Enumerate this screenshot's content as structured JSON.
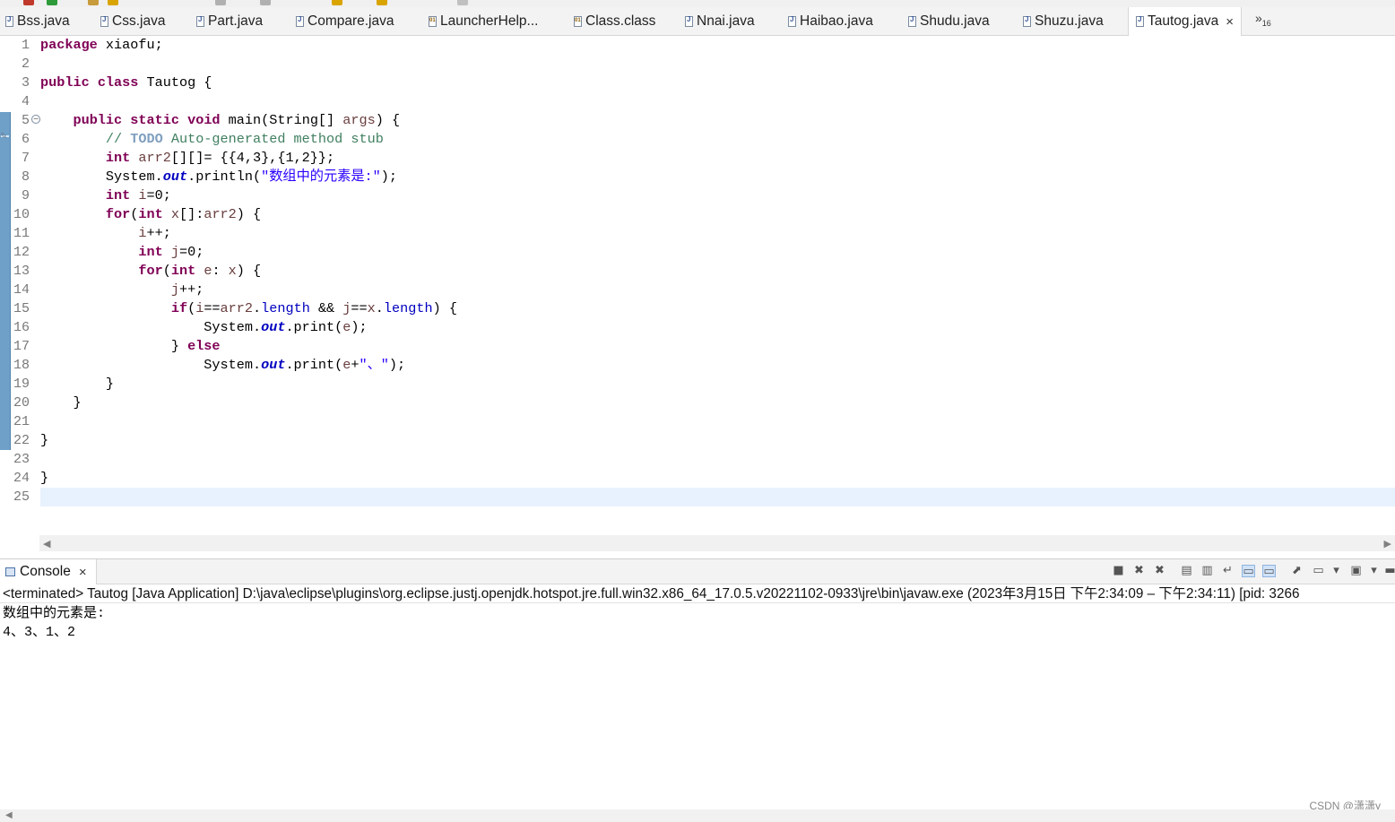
{
  "editor_tabs": [
    {
      "label": "Bss.java",
      "icon": "java-file-icon"
    },
    {
      "label": "Css.java",
      "icon": "java-file-icon"
    },
    {
      "label": "Part.java",
      "icon": "java-file-icon"
    },
    {
      "label": "Compare.java",
      "icon": "java-file-icon"
    },
    {
      "label": "LauncherHelp...",
      "icon": "class-file-icon"
    },
    {
      "label": "Class.class",
      "icon": "class-file-icon"
    },
    {
      "label": "Nnai.java",
      "icon": "java-file-icon"
    },
    {
      "label": "Haibao.java",
      "icon": "java-file-icon"
    },
    {
      "label": "Shudu.java",
      "icon": "java-file-icon"
    },
    {
      "label": "Shuzu.java",
      "icon": "java-file-icon"
    },
    {
      "label": "Tautog.java",
      "icon": "java-file-icon",
      "active": true,
      "close": "×"
    }
  ],
  "tab_overflow": {
    "symbol": "»",
    "count": "16"
  },
  "line_numbers": [
    "1",
    "2",
    "3",
    "4",
    "5",
    "6",
    "7",
    "8",
    "9",
    "10",
    "11",
    "12",
    "13",
    "14",
    "15",
    "16",
    "17",
    "18",
    "19",
    "20",
    "21",
    "22",
    "23",
    "24",
    "25"
  ],
  "code": {
    "l1_kw": "package",
    "l1_rest": " xiaofu;",
    "l3_kw1": "public",
    "l3_kw2": "class",
    "l3_rest": " Tautog {",
    "l5_kw1": "public",
    "l5_kw2": "static",
    "l5_kw3": "void",
    "l5_a": " main(String[] ",
    "l5_var": "args",
    "l5_b": ") {",
    "l6_a": "// ",
    "l6_todo": "TODO",
    "l6_b": " Auto-generated method stub",
    "l7_kw": "int",
    "l7_a": " ",
    "l7_var": "arr2",
    "l7_b": "[][]= {{4,3},{1,2}};",
    "l8_a": "System.",
    "l8_fld": "out",
    "l8_b": ".println(",
    "l8_str": "\"数组中的元素是:\"",
    "l8_c": ");",
    "l9_kw": "int",
    "l9_a": " ",
    "l9_var": "i",
    "l9_b": "=0;",
    "l10_kw1": "for",
    "l10_a": "(",
    "l10_kw2": "int",
    "l10_b": " ",
    "l10_var1": "x",
    "l10_c": "[]:",
    "l10_var2": "arr2",
    "l10_d": ") {",
    "l11_var": "i",
    "l11_a": "++;",
    "l12_kw": "int",
    "l12_a": " ",
    "l12_var": "j",
    "l12_b": "=0;",
    "l13_kw1": "for",
    "l13_a": "(",
    "l13_kw2": "int",
    "l13_b": " ",
    "l13_var1": "e",
    "l13_c": ": ",
    "l13_var2": "x",
    "l13_d": ") {",
    "l14_var": "j",
    "l14_a": "++;",
    "l15_kw": "if",
    "l15_a": "(",
    "l15_v1": "i",
    "l15_b": "==",
    "l15_v2": "arr2",
    "l15_c": ".",
    "l15_f1": "length",
    "l15_d": " && ",
    "l15_v3": "j",
    "l15_e": "==",
    "l15_v4": "x",
    "l15_g": ".",
    "l15_f2": "length",
    "l15_h": ") {",
    "l16_a": "System.",
    "l16_fld": "out",
    "l16_b": ".print(",
    "l16_var": "e",
    "l16_c": ");",
    "l17_a": "} ",
    "l17_kw": "else",
    "l18_a": "System.",
    "l18_fld": "out",
    "l18_b": ".print(",
    "l18_var": "e",
    "l18_c": "+",
    "l18_str": "\"、\"",
    "l18_d": ");",
    "l19": "}",
    "l20": "}",
    "l22": "}",
    "l24": "}"
  },
  "console": {
    "tab_label": "Console",
    "tab_close": "×",
    "terminated_line": "<terminated> Tautog [Java Application] D:\\java\\eclipse\\plugins\\org.eclipse.justj.openjdk.hotspot.jre.full.win32.x86_64_17.0.5.v20221102-0933\\jre\\bin\\javaw.exe  (2023年3月15日 下午2:34:09 – 下午2:34:11) [pid: 3266",
    "output": [
      "数组中的元素是:",
      "4、3、1、2"
    ],
    "watermark": "CSDN @潇潇y",
    "toolbar_icons": [
      "terminate-icon",
      "remove-launch-icon",
      "remove-all-icon",
      "clear-console-icon",
      "scroll-lock-icon",
      "word-wrap-icon",
      "show-on-stdout-icon",
      "show-on-stderr-icon",
      "pin-console-icon",
      "display-console-icon",
      "dropdown-icon",
      "open-console-icon",
      "dropdown-icon",
      "minimize-icon"
    ]
  },
  "colors": {
    "keyword": "#7f0055",
    "comment": "#3f7f5f",
    "string": "#2a00ff",
    "field": "#0000c0",
    "current_line": "#e8f2fe"
  }
}
